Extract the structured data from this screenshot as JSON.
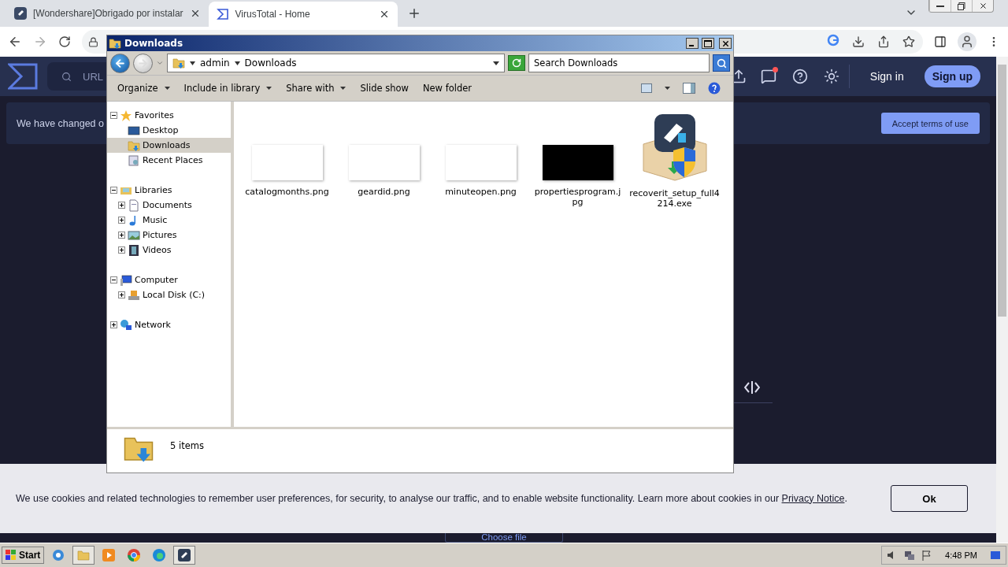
{
  "browser": {
    "tabs": [
      {
        "title": "[Wondershare]Obrigado por instalar",
        "selected": false
      },
      {
        "title": "VirusTotal - Home",
        "selected": true
      }
    ]
  },
  "site": {
    "search_placeholder": "URL",
    "sign_in": "Sign in",
    "sign_up": "Sign up",
    "notice": "We have changed o",
    "accept_button": "Accept terms of use",
    "choose_file": "Choose file",
    "cookie": {
      "text": "We use cookies and related technologies to remember user preferences, for security, to analyse our traffic, and to enable website functionality. Learn more about cookies in our",
      "link": "Privacy Notice",
      "end": ".",
      "button": "Ok"
    }
  },
  "explorer": {
    "title": "Downloads",
    "breadcrumb": [
      "admin",
      "Downloads"
    ],
    "search_placeholder": "Search Downloads",
    "toolbar": [
      {
        "label": "Organize",
        "dropdown": true
      },
      {
        "label": "Include in library",
        "dropdown": true
      },
      {
        "label": "Share with",
        "dropdown": true
      },
      {
        "label": "Slide show",
        "dropdown": false
      },
      {
        "label": "New folder",
        "dropdown": false
      }
    ],
    "tree": [
      {
        "label": "Favorites",
        "kind": "star",
        "expanded": true,
        "selected": false,
        "children": [
          {
            "label": "Desktop",
            "kind": "desktop",
            "selected": false
          },
          {
            "label": "Downloads",
            "kind": "downloads",
            "selected": true
          },
          {
            "label": "Recent Places",
            "kind": "recent",
            "selected": false
          }
        ]
      },
      {
        "label": "Libraries",
        "kind": "library",
        "expanded": true,
        "selected": false,
        "children": [
          {
            "label": "Documents",
            "kind": "documents",
            "expanded": false,
            "selected": false
          },
          {
            "label": "Music",
            "kind": "music",
            "expanded": false,
            "selected": false
          },
          {
            "label": "Pictures",
            "kind": "pictures",
            "expanded": false,
            "selected": false
          },
          {
            "label": "Videos",
            "kind": "videos",
            "expanded": false,
            "selected": false
          }
        ]
      },
      {
        "label": "Computer",
        "kind": "computer",
        "expanded": true,
        "selected": false,
        "children": [
          {
            "label": "Local Disk (C:)",
            "kind": "disk",
            "expanded": false,
            "selected": false
          }
        ]
      },
      {
        "label": "Network",
        "kind": "network",
        "expanded": false,
        "selected": false
      }
    ],
    "files": [
      {
        "name": "catalogmonths.png",
        "kind": "white"
      },
      {
        "name": "geardid.png",
        "kind": "white"
      },
      {
        "name": "minuteopen.png",
        "kind": "white"
      },
      {
        "name": "propertiesprogram.jpg",
        "kind": "black"
      },
      {
        "name": "recoverit_setup_full4214.exe",
        "kind": "installer"
      }
    ],
    "status": "5 items"
  },
  "taskbar": {
    "start": "Start",
    "clock": "4:48 PM"
  }
}
